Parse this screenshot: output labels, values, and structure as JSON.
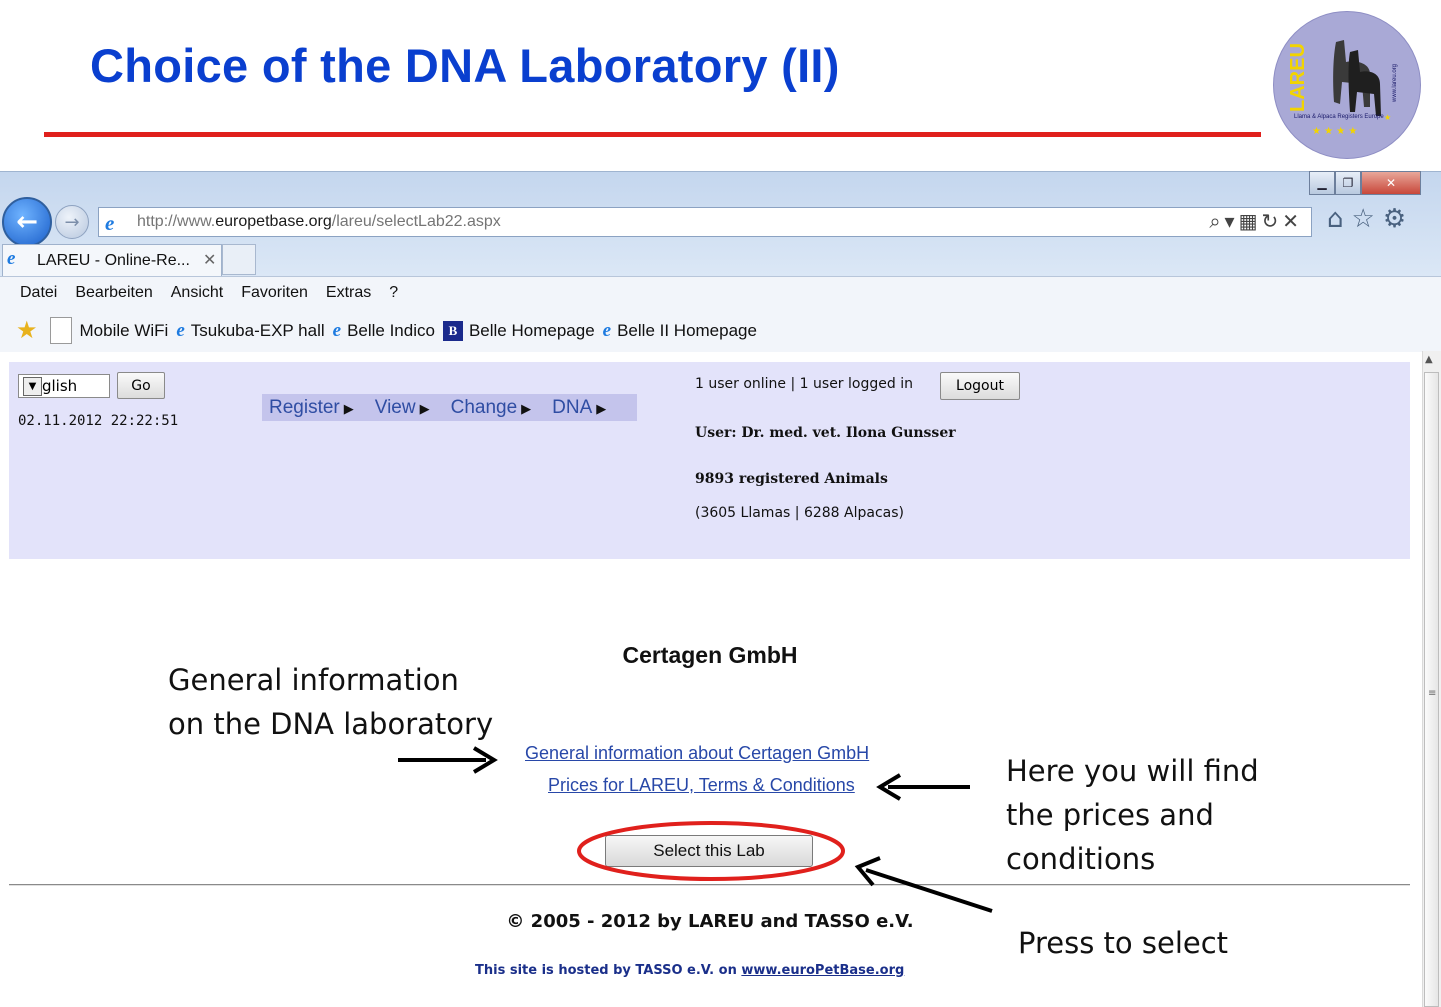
{
  "slide": {
    "title": "Choice of the DNA Laboratory (II)",
    "logo": {
      "text": "LAREU",
      "subtitle": "Llama & Alpaca Registers Europe",
      "url": "www.lareu.org"
    }
  },
  "browser": {
    "address_prefix": "http://www.",
    "address_domain": "europetbase.org",
    "address_path": "/lareu/selectLab22.aspx",
    "tab_title": "LAREU - Online-Re...",
    "menu": [
      "Datei",
      "Bearbeiten",
      "Ansicht",
      "Favoriten",
      "Extras",
      "?"
    ],
    "favorites": [
      "Mobile WiFi",
      "Tsukuba-EXP hall",
      "Belle Indico",
      "Belle Homepage",
      "Belle II Homepage"
    ]
  },
  "site": {
    "language": "English",
    "go_label": "Go",
    "datetime": "02.11.2012 22:22:51",
    "nav": [
      "Register",
      "View",
      "Change",
      "DNA"
    ],
    "online_status": "1 user online | 1 user logged in",
    "logout_label": "Logout",
    "user": "User: Dr. med. vet. Ilona Gunsser",
    "animals": "9893 registered Animals",
    "animals_detail": "(3605 Llamas | 6288 Alpacas)",
    "lab_name": "Certagen GmbH",
    "link_general": "General information about Certagen GmbH",
    "link_prices": "Prices for LAREU, Terms & Conditions",
    "select_label": "Select this Lab",
    "copyright": "© 2005 - 2012 by LAREU and TASSO e.V.",
    "hosted_text": "This site is hosted by TASSO e.V. on",
    "hosted_link": "www.euroPetBase.org"
  },
  "annotations": {
    "general_info_line1": "General information",
    "general_info_line2": "on the DNA laboratory",
    "prices_line1": "Here you will find",
    "prices_line2": "the prices and",
    "prices_line3": "conditions",
    "press_select": "Press to select"
  },
  "colors": {
    "title_blue": "#0a3fcf",
    "rule_red": "#e0201c",
    "header_bg": "#e3e3fa",
    "nav_bg": "#c4c4ec",
    "link_blue": "#2848a8"
  }
}
